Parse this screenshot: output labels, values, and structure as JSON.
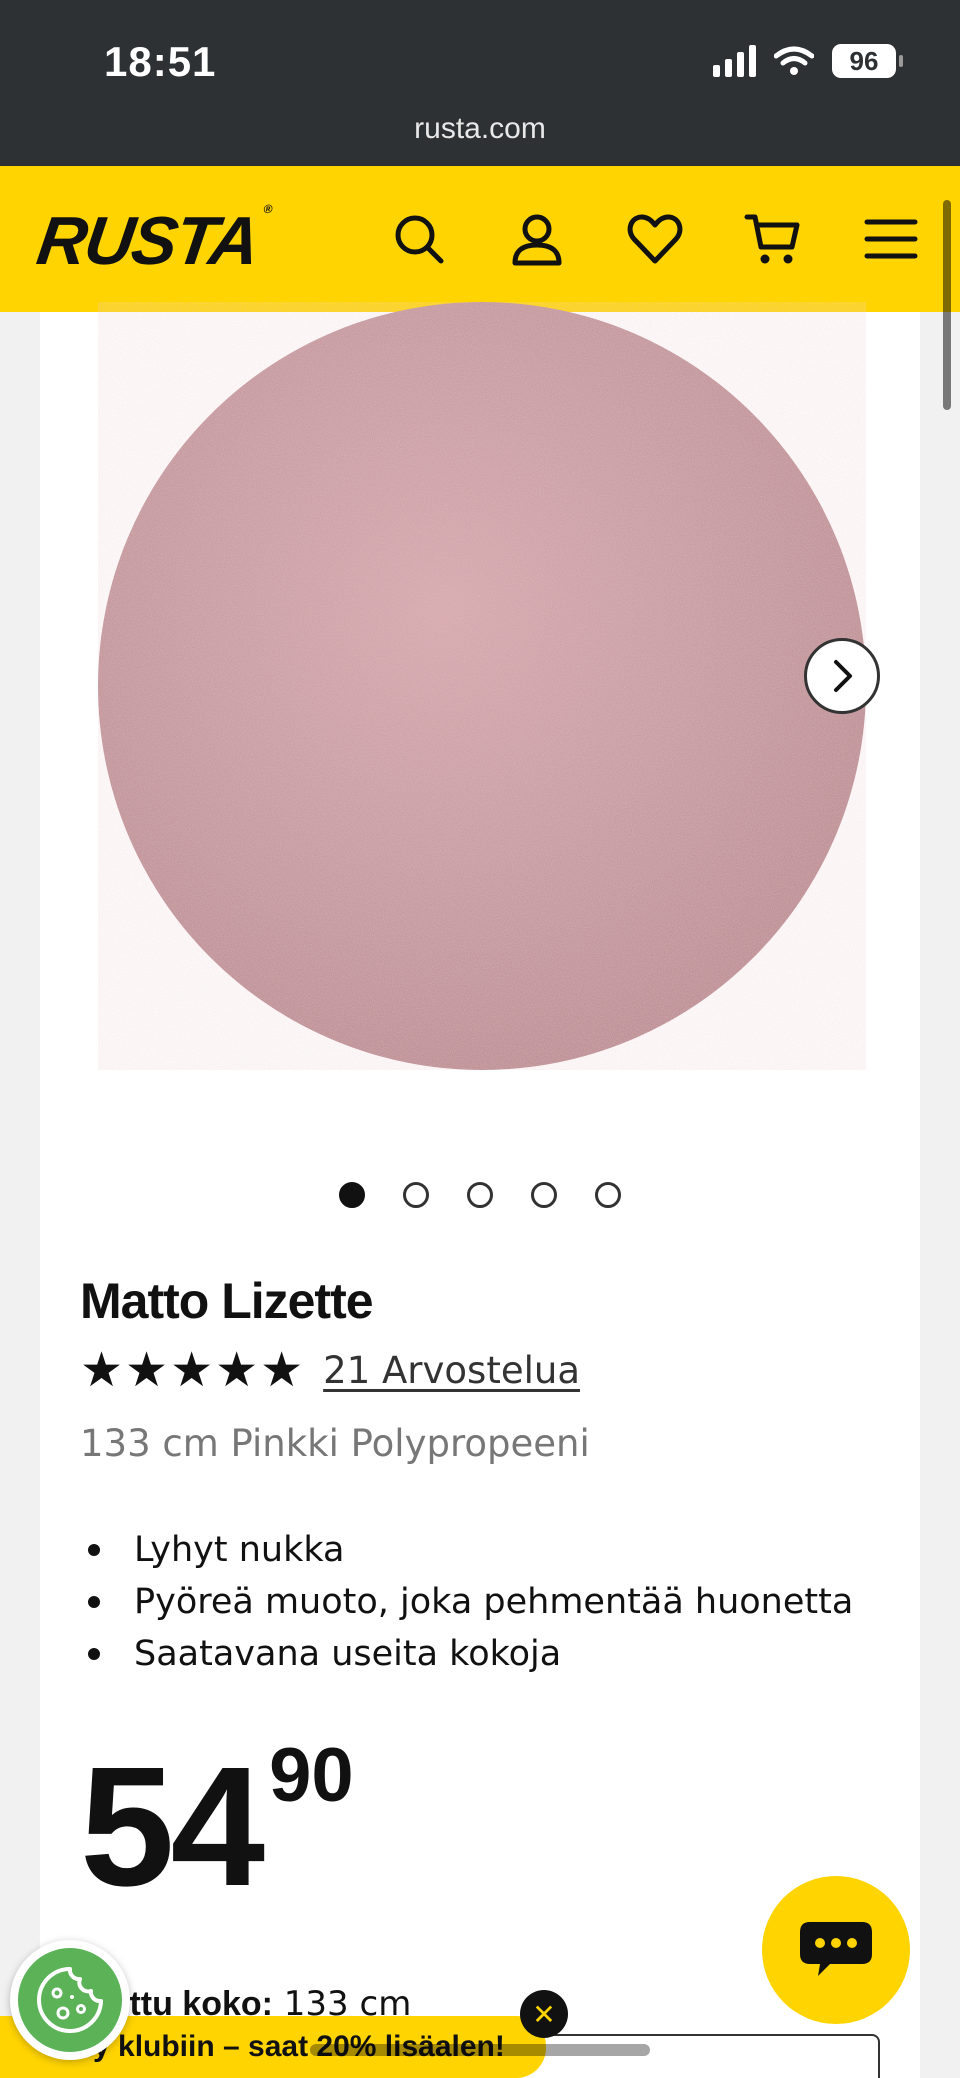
{
  "status_bar": {
    "time": "18:51",
    "battery": "96"
  },
  "browser": {
    "url": "rusta.com"
  },
  "header": {
    "logo": "RUSTA",
    "logo_mark": "®",
    "icons": [
      "search-icon",
      "account-icon",
      "heart-icon",
      "cart-icon",
      "menu-icon"
    ],
    "accent_color": "#ffd400"
  },
  "gallery": {
    "image": "pink-round-rug",
    "image_color": "#c2959a",
    "total_images": 5,
    "active_index": 1
  },
  "product": {
    "title": "Matto Lizette",
    "stars": "★★★★★",
    "rating": 5,
    "reviews": "21 Arvostelua",
    "subtitle": "133 cm Pinkki Polypropeeni",
    "features": [
      "Lyhyt nukka",
      "Pyöreä muoto, joka pehmentää huonetta",
      "Saatavana useita kokoja"
    ],
    "price_main": "54",
    "price_decimals": "90",
    "size_label": "ittu koko:",
    "size_value": "133 cm"
  },
  "promo": {
    "text": "Liity klubiin – saat 20% lisäalen!",
    "close": "✕"
  }
}
